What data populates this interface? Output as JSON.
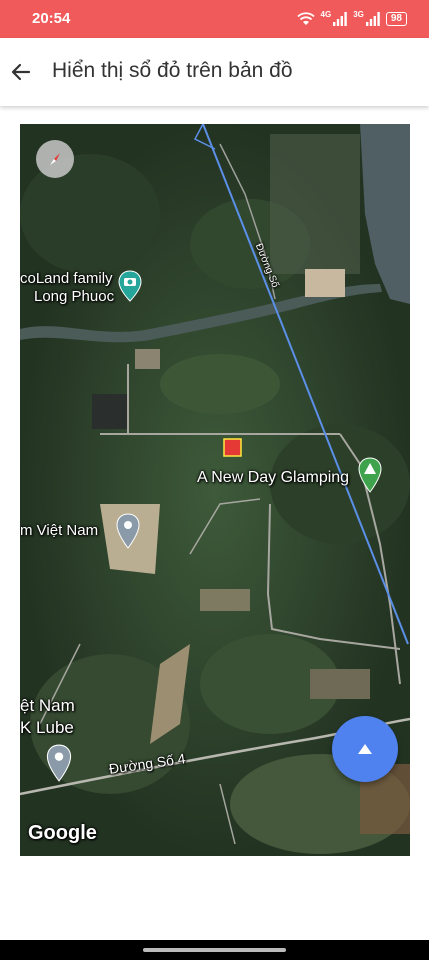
{
  "status_bar": {
    "time": "20:54",
    "signal1_label": "4G",
    "signal2_label": "3G",
    "battery": "98",
    "icons": [
      "wifi-icon",
      "cell-signal-icon",
      "cell-signal-icon",
      "battery-icon"
    ]
  },
  "app_bar": {
    "back_icon": "arrow-left-icon",
    "title": "Hiển thị sổ đỏ trên bản đồ"
  },
  "map": {
    "labels": {
      "ecoland": "coLand family",
      "long_phuoc": "Long Phuoc",
      "glamping": "A New Day Glamping",
      "viet_nam": "m Việt Nam",
      "viet_nam2": "ệt Nam",
      "lube": "K Lube",
      "road_so": "Đường Số",
      "road_so4": "Đường Số 4",
      "google": "Google"
    },
    "markers": [
      "camera-pin-icon",
      "campground-pin-icon",
      "place-pin-icon",
      "place-pin-icon"
    ],
    "highlight_parcel_color": "#e53935",
    "boundary_line_color": "#5b8fe8",
    "compass_icon": "compass-icon",
    "fab_icon": "triangle-up-icon"
  },
  "colors": {
    "status_bar": "#f05a5a",
    "fab": "#4f82ee"
  }
}
